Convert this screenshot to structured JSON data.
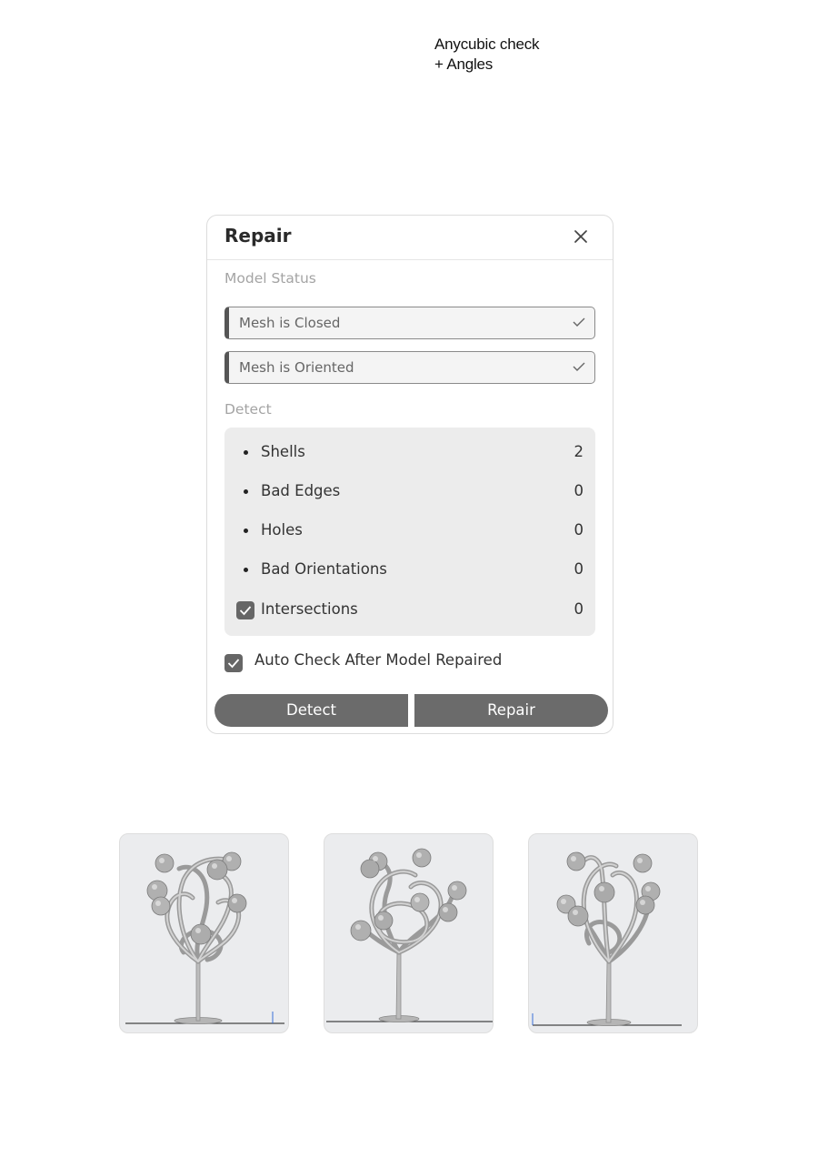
{
  "page_note": {
    "line1": "Anycubic check",
    "line2": "+ Angles"
  },
  "dialog": {
    "title": "Repair",
    "close_icon": "close-icon",
    "model_status_label": "Model Status",
    "status_items": [
      {
        "label": "Mesh is Closed",
        "icon": "checkmark-icon"
      },
      {
        "label": "Mesh is Oriented",
        "icon": "checkmark-icon"
      }
    ],
    "detect_label": "Detect",
    "detect_items": [
      {
        "name": "Shells",
        "value": "2"
      },
      {
        "name": "Bad Edges",
        "value": "0"
      },
      {
        "name": "Holes",
        "value": "0"
      },
      {
        "name": "Bad Orientations",
        "value": "0"
      },
      {
        "name": "Intersections",
        "value": "0",
        "checked": true
      }
    ],
    "auto_check": {
      "label": "Auto Check After Model Repaired",
      "checked": true
    },
    "buttons": {
      "detect": "Detect",
      "repair": "Repair"
    }
  },
  "thumbnails": [
    {
      "view": "front"
    },
    {
      "view": "angle"
    },
    {
      "view": "side"
    }
  ],
  "colors": {
    "button_bg": "#6b6b6b",
    "checkbox_bg": "#666666",
    "detect_panel_bg": "#ececec",
    "thumbnail_bg": "#ebecee"
  }
}
